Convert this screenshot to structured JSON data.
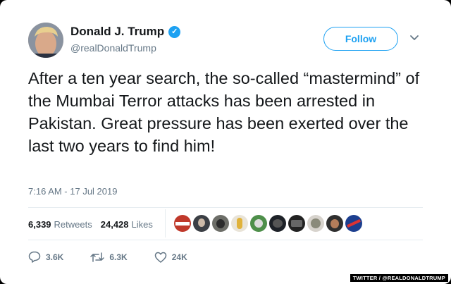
{
  "user": {
    "name": "Donald J. Trump",
    "handle": "@realDonaldTrump",
    "verified_mark": "✓"
  },
  "follow_label": "Follow",
  "tweet": {
    "text": "After a ten year search, the so-called “mastermind” of the Mumbai Terror attacks has been arrested in Pakistan. Great pressure has been exerted over the last two years to find him!",
    "timestamp": "7:16 AM - 17 Jul 2019"
  },
  "stats": {
    "retweets_count": "6,339",
    "retweets_label": "Retweets",
    "likes_count": "24,428",
    "likes_label": "Likes"
  },
  "actions": {
    "replies": "3.6K",
    "retweets": "6.3K",
    "likes": "24K"
  },
  "credit": "TWITTER / @REALDONALDTRUMP",
  "colors": {
    "accent": "#1da1f2",
    "text": "#14171a",
    "muted": "#657786"
  },
  "icons": [
    "verified-badge-icon",
    "chevron-down-icon",
    "reply-icon",
    "retweet-icon",
    "like-icon"
  ]
}
